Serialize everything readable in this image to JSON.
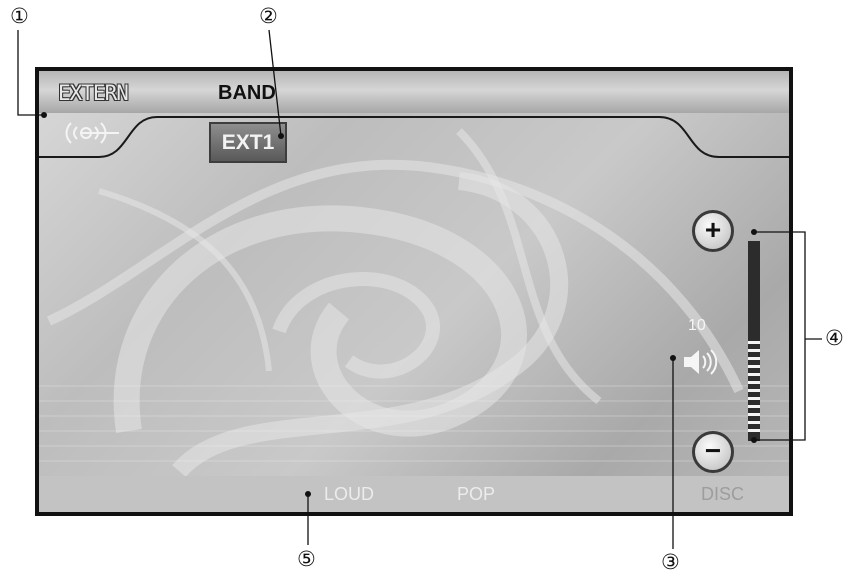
{
  "callouts": [
    "①",
    "②",
    "③",
    "④",
    "⑤"
  ],
  "screen": {
    "source_label": "EXTERN",
    "band_label": "BAND",
    "band_value": "EXT1",
    "volume": {
      "value": "10",
      "plus_label": "+",
      "minus_label": "−"
    },
    "bottom_bar": {
      "loud": "LOUD",
      "pop": "POP",
      "disc": "DISC"
    }
  },
  "colors": {
    "border": "#111111",
    "screen_bg": "#bdbdbd",
    "label_light": "#ececec",
    "disc_dim": "#9d9d9d"
  },
  "icons": [
    "source-signal-icon",
    "speaker-icon"
  ]
}
